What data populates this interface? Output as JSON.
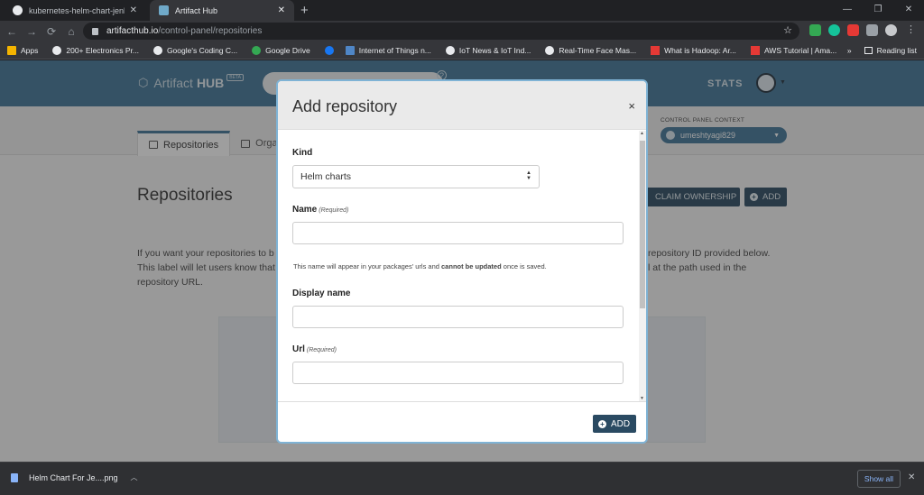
{
  "browser": {
    "tabs": [
      {
        "title": "kubernetes-helm-chart-jenkins/c",
        "close": "✕"
      },
      {
        "title": "Artifact Hub",
        "close": "✕"
      }
    ],
    "new_tab": "+",
    "window_controls": [
      "—",
      "❐",
      "✕"
    ],
    "url_host": "artifacthub.io",
    "url_path": "/control-panel/repositories",
    "bookmarks": [
      {
        "label": "Apps",
        "icon": "apps-grid-icon",
        "color": "#f4b400"
      },
      {
        "label": "200+ Electronics Pr...",
        "icon": "electronics-icon",
        "color": "#e8eaed"
      },
      {
        "label": "Google's Coding C...",
        "icon": "google-icon",
        "color": "#e8eaed"
      },
      {
        "label": "Google Drive",
        "icon": "google-drive-icon",
        "color": "#34a853"
      },
      {
        "label": "",
        "icon": "facebook-icon",
        "color": "#1877f2"
      },
      {
        "label": "Internet of Things n...",
        "icon": "iot-icon",
        "color": "#4f86c6"
      },
      {
        "label": "IoT News & IoT Ind...",
        "icon": "globe-icon",
        "color": "#e8eaed"
      },
      {
        "label": "Real-Time Face Mas...",
        "icon": "globe-icon",
        "color": "#e8eaed"
      },
      {
        "label": "What is Hadoop: Ar...",
        "icon": "edureka-icon",
        "color": "#e53935"
      },
      {
        "label": "AWS Tutorial | Ama...",
        "icon": "edureka-icon",
        "color": "#e53935"
      }
    ],
    "bookmarks_more": "»",
    "reading_list": "Reading list"
  },
  "site": {
    "brand": "Artifact",
    "brand_bold": "HUB",
    "beta": "BETA",
    "help": "?",
    "stats": "STATS",
    "tabs": [
      {
        "label": "Repositories"
      },
      {
        "label": "Organ"
      }
    ],
    "context_label": "CONTROL PANEL CONTEXT",
    "context_value": "umeshtyagi829",
    "page_title": "Repositories",
    "claim_label": "CLAIM OWNERSHIP",
    "add_label": "ADD",
    "para_left": [
      "If you want your repositories to b",
      "This label will let users know that",
      "repository URL."
    ],
    "para_right": [
      "repository ID provided below.",
      "l at the path used in the"
    ]
  },
  "modal": {
    "title": "Add repository",
    "close": "×",
    "kind_label": "Kind",
    "kind_value": "Helm charts",
    "name_label": "Name",
    "required": "(Required)",
    "name_hint_pre": "This name will appear in your packages' urls and ",
    "name_hint_bold": "cannot be updated",
    "name_hint_post": " once is saved.",
    "display_label": "Display name",
    "url_label": "Url",
    "add_label": "ADD"
  },
  "downloads": {
    "file": "Helm Chart For Je....png",
    "show_all": "Show all"
  },
  "colors": {
    "navbar": "#417598",
    "button_dark": "#2a4a62",
    "modal_border": "#7fb3d5"
  }
}
